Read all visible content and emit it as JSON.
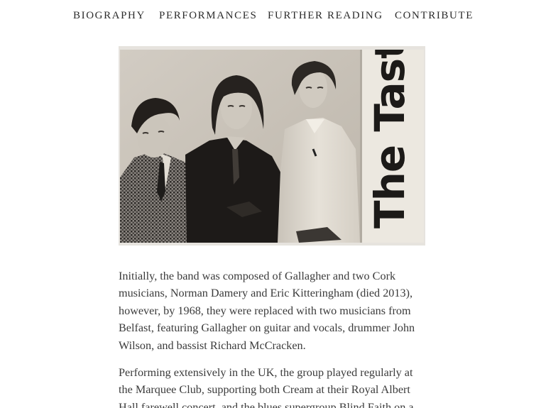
{
  "nav": {
    "items": [
      {
        "label": "BIOGRAPHY"
      },
      {
        "label": "PERFORMANCES"
      },
      {
        "label": "FURTHER READING"
      },
      {
        "label": "CONTRIBUTE"
      }
    ]
  },
  "photo": {
    "card_text": "The Taste"
  },
  "article": {
    "paragraphs": [
      "Initially, the band was composed of Gallagher and two Cork musicians, Norman Damery and Eric Kitteringham (died 2013), however, by 1968, they were replaced with two musicians from Belfast, featuring Gallagher on guitar and vocals, drummer John Wilson, and bassist Richard McCracken.",
      "Performing extensively in the UK, the group played regularly at the Marquee Club, supporting both Cream at their Royal Albert Hall farewell concert, and the blues supergroup Blind Faith on a"
    ]
  }
}
